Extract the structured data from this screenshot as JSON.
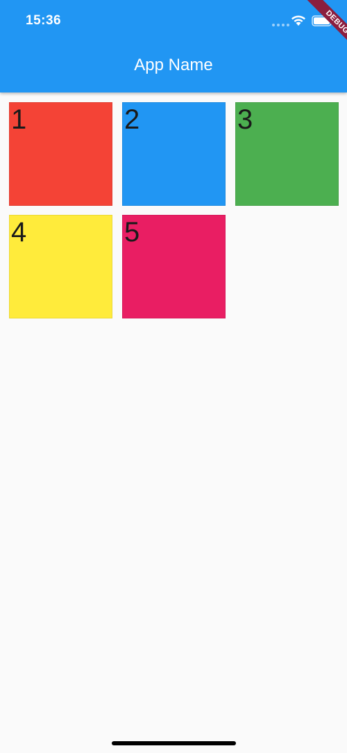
{
  "status_bar": {
    "time": "15:36"
  },
  "app_bar": {
    "title": "App Name",
    "color": "#2196f3"
  },
  "debug_banner": {
    "label": "DEBUG"
  },
  "tiles": [
    {
      "number": "1",
      "color": "#f44336"
    },
    {
      "number": "2",
      "color": "#2196f3"
    },
    {
      "number": "3",
      "color": "#4caf50"
    },
    {
      "number": "4",
      "color": "#ffeb3b"
    },
    {
      "number": "5",
      "color": "#e91e63"
    }
  ]
}
